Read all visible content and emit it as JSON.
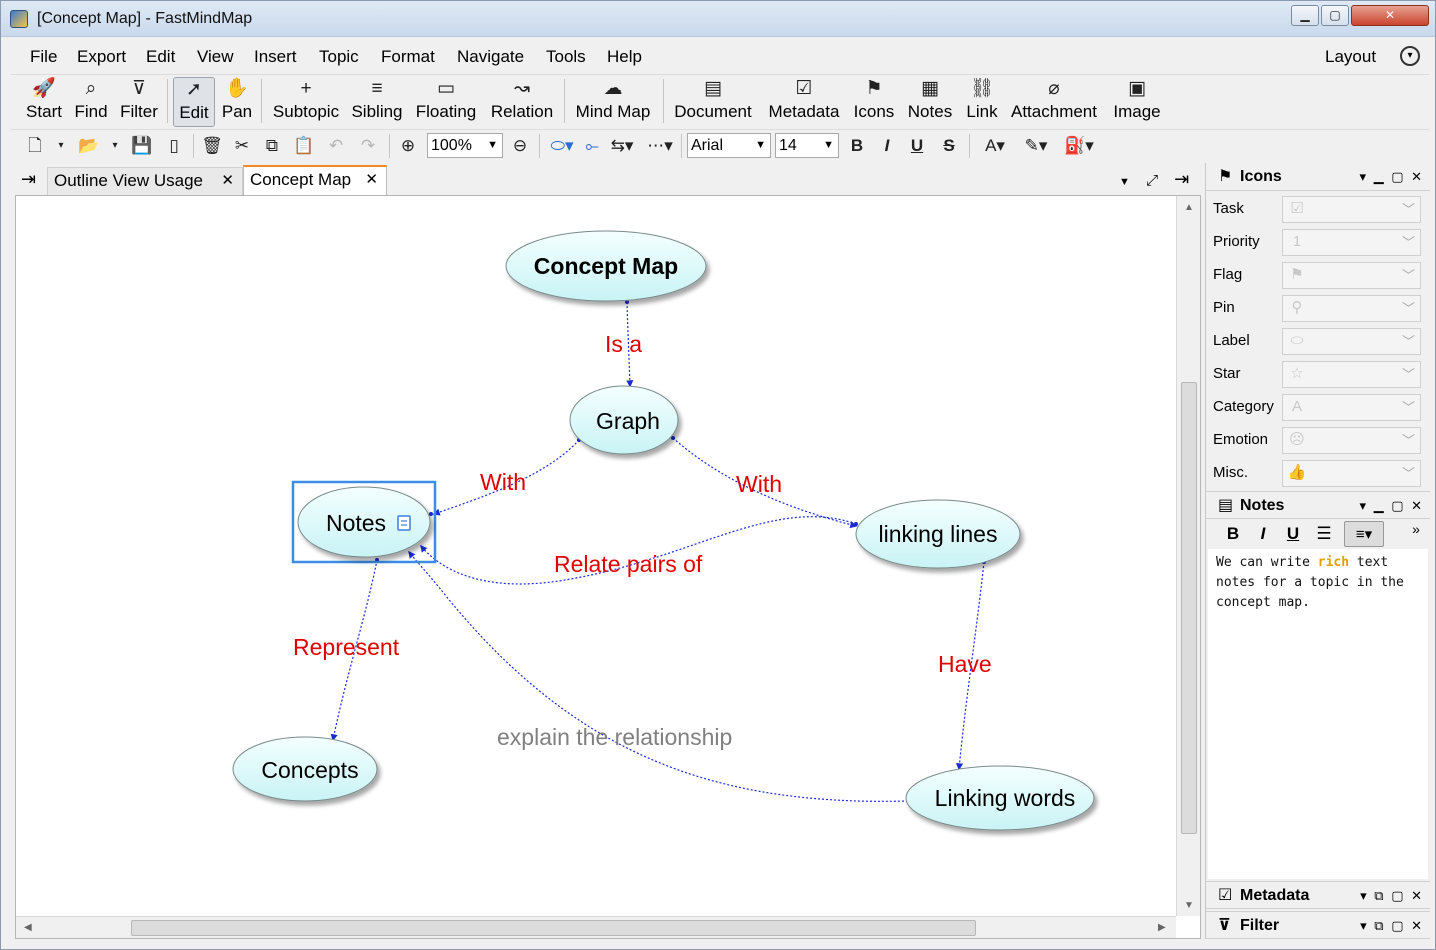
{
  "window": {
    "title": "[Concept Map] - FastMindMap",
    "controls": {
      "minimize": "▁",
      "maximize": "▢",
      "close": "✕"
    }
  },
  "menu": {
    "items": [
      {
        "label": "File"
      },
      {
        "label": "Export"
      },
      {
        "label": "Edit"
      },
      {
        "label": "View"
      },
      {
        "label": "Insert"
      },
      {
        "label": "Topic"
      },
      {
        "label": "Format"
      },
      {
        "label": "Navigate"
      },
      {
        "label": "Tools"
      },
      {
        "label": "Help"
      }
    ],
    "layout_label": "Layout"
  },
  "toolbar": {
    "buttons": [
      {
        "label": "Start",
        "icon": "rocket-icon",
        "glyph": "🚀"
      },
      {
        "label": "Find",
        "icon": "find-icon",
        "glyph": "⌕"
      },
      {
        "label": "Filter",
        "icon": "filter-icon",
        "glyph": "⊽"
      },
      {
        "label": "Edit",
        "icon": "cursor-icon",
        "glyph": "➚",
        "active": true
      },
      {
        "label": "Pan",
        "icon": "hand-icon",
        "glyph": "✋"
      },
      {
        "label": "Subtopic",
        "icon": "plus-icon",
        "glyph": "+"
      },
      {
        "label": "Sibling",
        "icon": "sibling-icon",
        "glyph": "≡"
      },
      {
        "label": "Floating",
        "icon": "floating-icon",
        "glyph": "▭"
      },
      {
        "label": "Relation",
        "icon": "relation-icon",
        "glyph": "↝"
      },
      {
        "label": "Mind Map",
        "icon": "brain-icon",
        "glyph": "☁"
      },
      {
        "label": "Document",
        "icon": "document-icon",
        "glyph": "▤"
      },
      {
        "label": "Metadata",
        "icon": "metadata-icon",
        "glyph": "☑"
      },
      {
        "label": "Icons",
        "icon": "flag-icon",
        "glyph": "⚑"
      },
      {
        "label": "Notes",
        "icon": "notes-icon",
        "glyph": "▦"
      },
      {
        "label": "Link",
        "icon": "link-icon",
        "glyph": "⛓"
      },
      {
        "label": "Attachment",
        "icon": "paperclip-icon",
        "glyph": "⌀"
      },
      {
        "label": "Image",
        "icon": "image-icon",
        "glyph": "▣"
      }
    ]
  },
  "format_bar": {
    "zoom": "100%",
    "font_family": "Arial",
    "font_size": "14",
    "bold": "B",
    "italic": "I",
    "underline": "U",
    "strike": "S"
  },
  "tabs": [
    {
      "label": "Outline View Usage",
      "active": false
    },
    {
      "label": "Concept Map",
      "active": true
    }
  ],
  "map": {
    "nodes": [
      {
        "id": "concept-map",
        "label": "Concept Map",
        "bold": true
      },
      {
        "id": "graph",
        "label": "Graph"
      },
      {
        "id": "notes",
        "label": "Notes",
        "selected": true,
        "has_note": true
      },
      {
        "id": "linking-lines",
        "label": "linking lines"
      },
      {
        "id": "concepts",
        "label": "Concepts"
      },
      {
        "id": "linking-words",
        "label": "Linking words"
      }
    ],
    "relations": [
      {
        "from": "concept-map",
        "to": "graph",
        "label": "Is a"
      },
      {
        "from": "graph",
        "to": "notes",
        "label": "With"
      },
      {
        "from": "graph",
        "to": "linking-lines",
        "label": "With"
      },
      {
        "from": "linking-lines",
        "to": "notes",
        "label": "Relate pairs of"
      },
      {
        "from": "notes",
        "to": "concepts",
        "label": "Represent"
      },
      {
        "from": "linking-lines",
        "to": "linking-words",
        "label": "Have"
      },
      {
        "from": "linking-words",
        "to": "notes",
        "label": "explain the relationship"
      }
    ],
    "colors": {
      "node_fill_top": "#f4ffff",
      "node_fill_bottom": "#c9f3f5",
      "relation_line": "#1a2bd6",
      "relation_label": "#e00000",
      "floating_label": "#808080",
      "selection": "#3a8ee6"
    }
  },
  "right_panel": {
    "icons_panel": {
      "title": "Icons",
      "rows": [
        {
          "label": "Task",
          "icon": "checkbox-icon",
          "glyph": "☑"
        },
        {
          "label": "Priority",
          "icon": "priority-icon",
          "glyph": "1"
        },
        {
          "label": "Flag",
          "icon": "flag-icon",
          "glyph": "⚑"
        },
        {
          "label": "Pin",
          "icon": "pin-icon",
          "glyph": "⚲"
        },
        {
          "label": "Label",
          "icon": "label-icon",
          "glyph": "⬭"
        },
        {
          "label": "Star",
          "icon": "star-icon",
          "glyph": "☆"
        },
        {
          "label": "Category",
          "icon": "category-icon",
          "glyph": "A"
        },
        {
          "label": "Emotion",
          "icon": "emotion-icon",
          "glyph": "☹"
        },
        {
          "label": "Misc.",
          "icon": "thumbs-up-icon",
          "glyph": "👍"
        }
      ]
    },
    "notes_panel": {
      "title": "Notes",
      "text_before": "We can write ",
      "text_rich": "rich",
      "text_after": " text notes for a topic in the concept map."
    },
    "metadata_panel": {
      "title": "Metadata"
    },
    "filter_panel": {
      "title": "Filter"
    }
  }
}
